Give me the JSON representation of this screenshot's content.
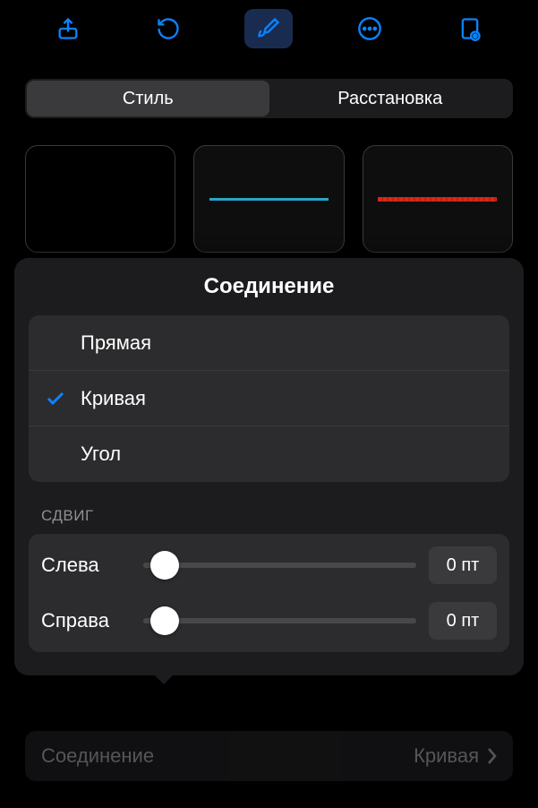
{
  "toolbar": {
    "icons": [
      "share",
      "undo",
      "brush",
      "more",
      "document"
    ]
  },
  "segmented": {
    "tabs": [
      "Стиль",
      "Расстановка"
    ],
    "selected": 0
  },
  "sheet": {
    "title": "Соединение",
    "options": [
      {
        "label": "Прямая",
        "checked": false
      },
      {
        "label": "Кривая",
        "checked": true
      },
      {
        "label": "Угол",
        "checked": false
      }
    ],
    "section_header": "СДВИГ",
    "sliders": [
      {
        "label": "Слева",
        "value": "0 пт",
        "position": 0
      },
      {
        "label": "Справа",
        "value": "0 пт",
        "position": 0
      }
    ]
  },
  "bottom": {
    "label": "Соединение",
    "value": "Кривая"
  },
  "colors": {
    "accent": "#0a84ff"
  }
}
